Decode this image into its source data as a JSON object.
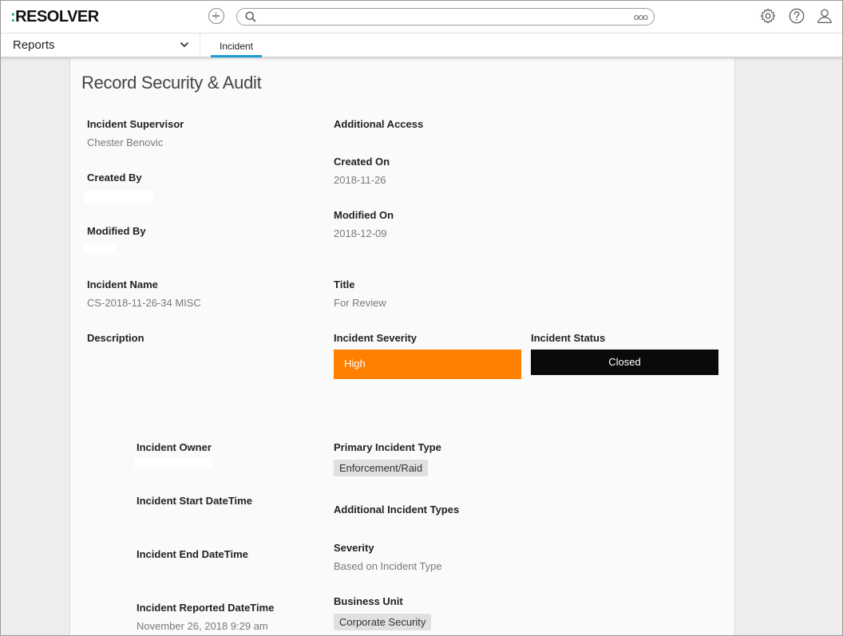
{
  "header": {
    "logo_dots": ":",
    "logo_text": "RESOLVER",
    "search_placeholder": "",
    "more_label": "ooo"
  },
  "nav": {
    "reports_label": "Reports",
    "tab_label": "Incident"
  },
  "card": {
    "title": "Record Security & Audit"
  },
  "fields": {
    "incident_supervisor": {
      "label": "Incident Supervisor",
      "value": "Chester Benovic"
    },
    "additional_access": {
      "label": "Additional Access"
    },
    "created_by": {
      "label": "Created By"
    },
    "created_on": {
      "label": "Created On",
      "value": "2018-11-26"
    },
    "modified_by": {
      "label": "Modified By"
    },
    "modified_on": {
      "label": "Modified On",
      "value": "2018-12-09"
    },
    "incident_name": {
      "label": "Incident Name",
      "value": "CS-2018-11-26-34 MISC"
    },
    "title": {
      "label": "Title",
      "value": "For Review"
    },
    "description": {
      "label": "Description"
    },
    "incident_severity": {
      "label": "Incident Severity",
      "value": "High",
      "color": "#ff7f00"
    },
    "incident_status": {
      "label": "Incident Status",
      "value": "Closed",
      "color": "#0a0a0a"
    },
    "incident_owner": {
      "label": "Incident Owner"
    },
    "primary_incident_type": {
      "label": "Primary Incident Type",
      "value": "Enforcement/Raid"
    },
    "incident_start": {
      "label": "Incident Start DateTime"
    },
    "additional_incident_types": {
      "label": "Additional Incident Types"
    },
    "incident_end": {
      "label": "Incident End DateTime"
    },
    "severity": {
      "label": "Severity",
      "value": "Based on Incident Type"
    },
    "incident_reported": {
      "label": "Incident Reported DateTime",
      "value": "November 26, 2018 9:29 am"
    },
    "business_unit": {
      "label": "Business Unit",
      "value": "Corporate Security"
    }
  },
  "colors": {
    "accent": "#1b9ad6",
    "logo_dot": "#1aa58c"
  },
  "icons": [
    "add-icon",
    "search-icon",
    "more-icon",
    "gear-icon",
    "help-icon",
    "user-icon",
    "chevron-down-icon"
  ]
}
